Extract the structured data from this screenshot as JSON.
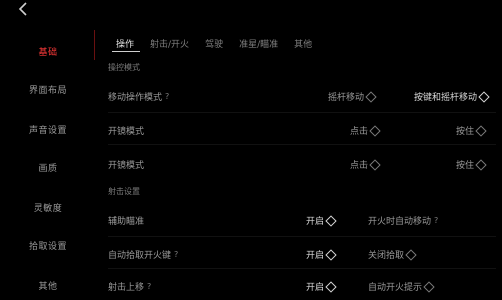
{
  "nav": {
    "back_icon": "chevron-left-icon"
  },
  "sidebar": {
    "items": [
      {
        "label": "基础"
      },
      {
        "label": "界面布局"
      },
      {
        "label": "声音设置"
      },
      {
        "label": "画质"
      },
      {
        "label": "灵敏度"
      },
      {
        "label": "拾取设置"
      },
      {
        "label": "其他"
      }
    ]
  },
  "tabs": [
    {
      "label": "操作"
    },
    {
      "label": "射击/开火"
    },
    {
      "label": "驾驶"
    },
    {
      "label": "准星/瞄准"
    },
    {
      "label": "其他"
    }
  ],
  "sections": {
    "s1": "操控模式",
    "s2": "射击设置"
  },
  "rows": [
    {
      "label": "移动操作模式",
      "hint": "?",
      "opt1": "摇杆移动",
      "opt2": "按键和摇杆移动"
    },
    {
      "label": "开镜模式",
      "hint": "",
      "opt1": "点击",
      "opt2": "按住"
    },
    {
      "label": "开镜模式",
      "hint": "",
      "opt1": "点击",
      "opt2": "按住"
    },
    {
      "label": "辅助瞄准",
      "hint": "",
      "opt1": "开启",
      "opt2": "开火时自动移动",
      "opt2_hint": "?"
    },
    {
      "label": "自动拾取开火键",
      "hint": "?",
      "opt1": "开启",
      "opt2": "关闭拾取"
    },
    {
      "label": "射击上移",
      "hint": "?",
      "opt1": "开启",
      "opt2": "自动开火提示"
    }
  ],
  "colors": {
    "accent": "#ff3a3a",
    "background": "#000000"
  }
}
